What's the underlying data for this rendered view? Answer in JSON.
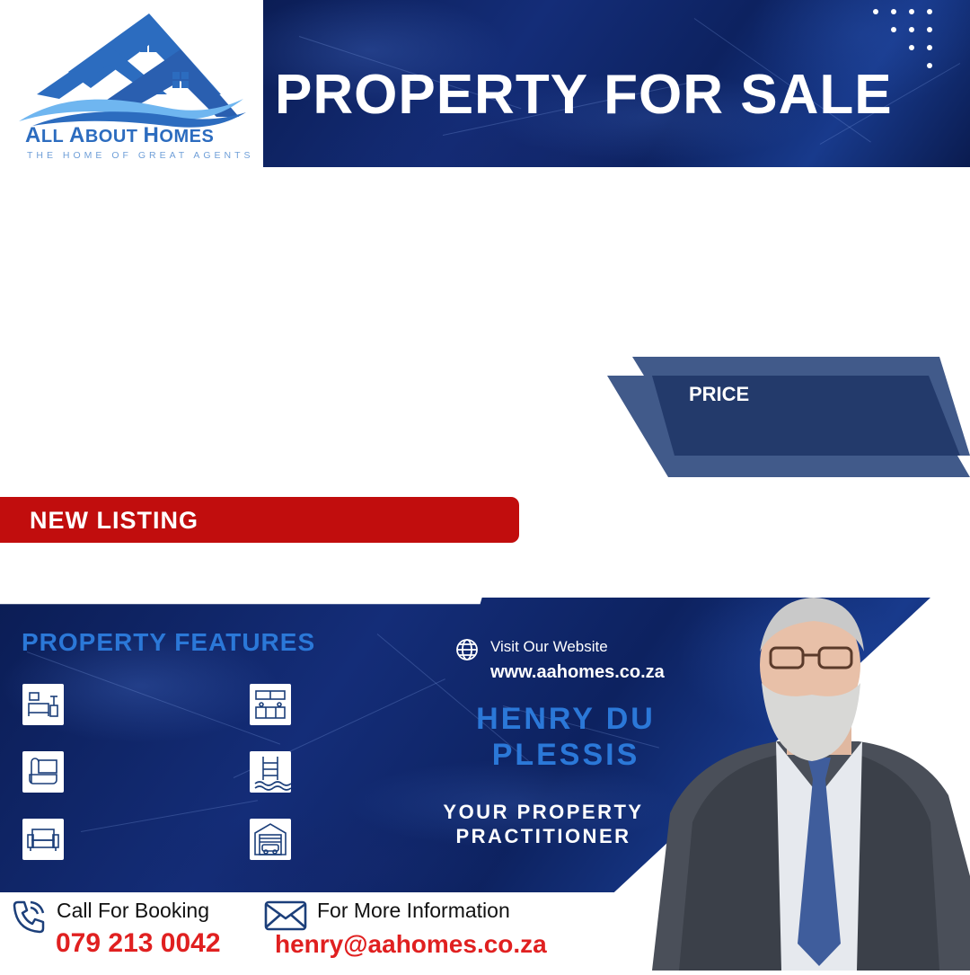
{
  "brand": {
    "name": "All About Homes",
    "name_parts": [
      "A",
      "LL ",
      "A",
      "BOUT ",
      "H",
      "OMES"
    ],
    "tagline": "THE HOME OF GREAT AGENTS",
    "primary_color": "#2c6cbf",
    "accent_light": "#6fb6f0"
  },
  "header": {
    "title": "PROPERTY FOR SALE"
  },
  "price": {
    "label": "PRICE",
    "panel_color": "#233a6b",
    "back_color": "#415a8a"
  },
  "listing_banner": {
    "label": "NEW LISTING",
    "color": "#c10d0d"
  },
  "features": {
    "title": "PROPERTY FEATURES",
    "icons": [
      "bedroom-icon",
      "kitchen-icon",
      "bathroom-icon",
      "pool-icon",
      "lounge-icon",
      "garage-icon"
    ]
  },
  "website": {
    "label": "Visit Our Website",
    "url": "www.aahomes.co.za",
    "icon": "globe-icon"
  },
  "agent": {
    "name": "HENRY DU PLESSIS",
    "role": "YOUR PROPERTY PRACTITIONER"
  },
  "contact": {
    "call_label": "Call For Booking",
    "phone": "079 213 0042",
    "info_label": "For More Information",
    "email": "henry@aahomes.co.za",
    "highlight_color": "#e02020"
  }
}
